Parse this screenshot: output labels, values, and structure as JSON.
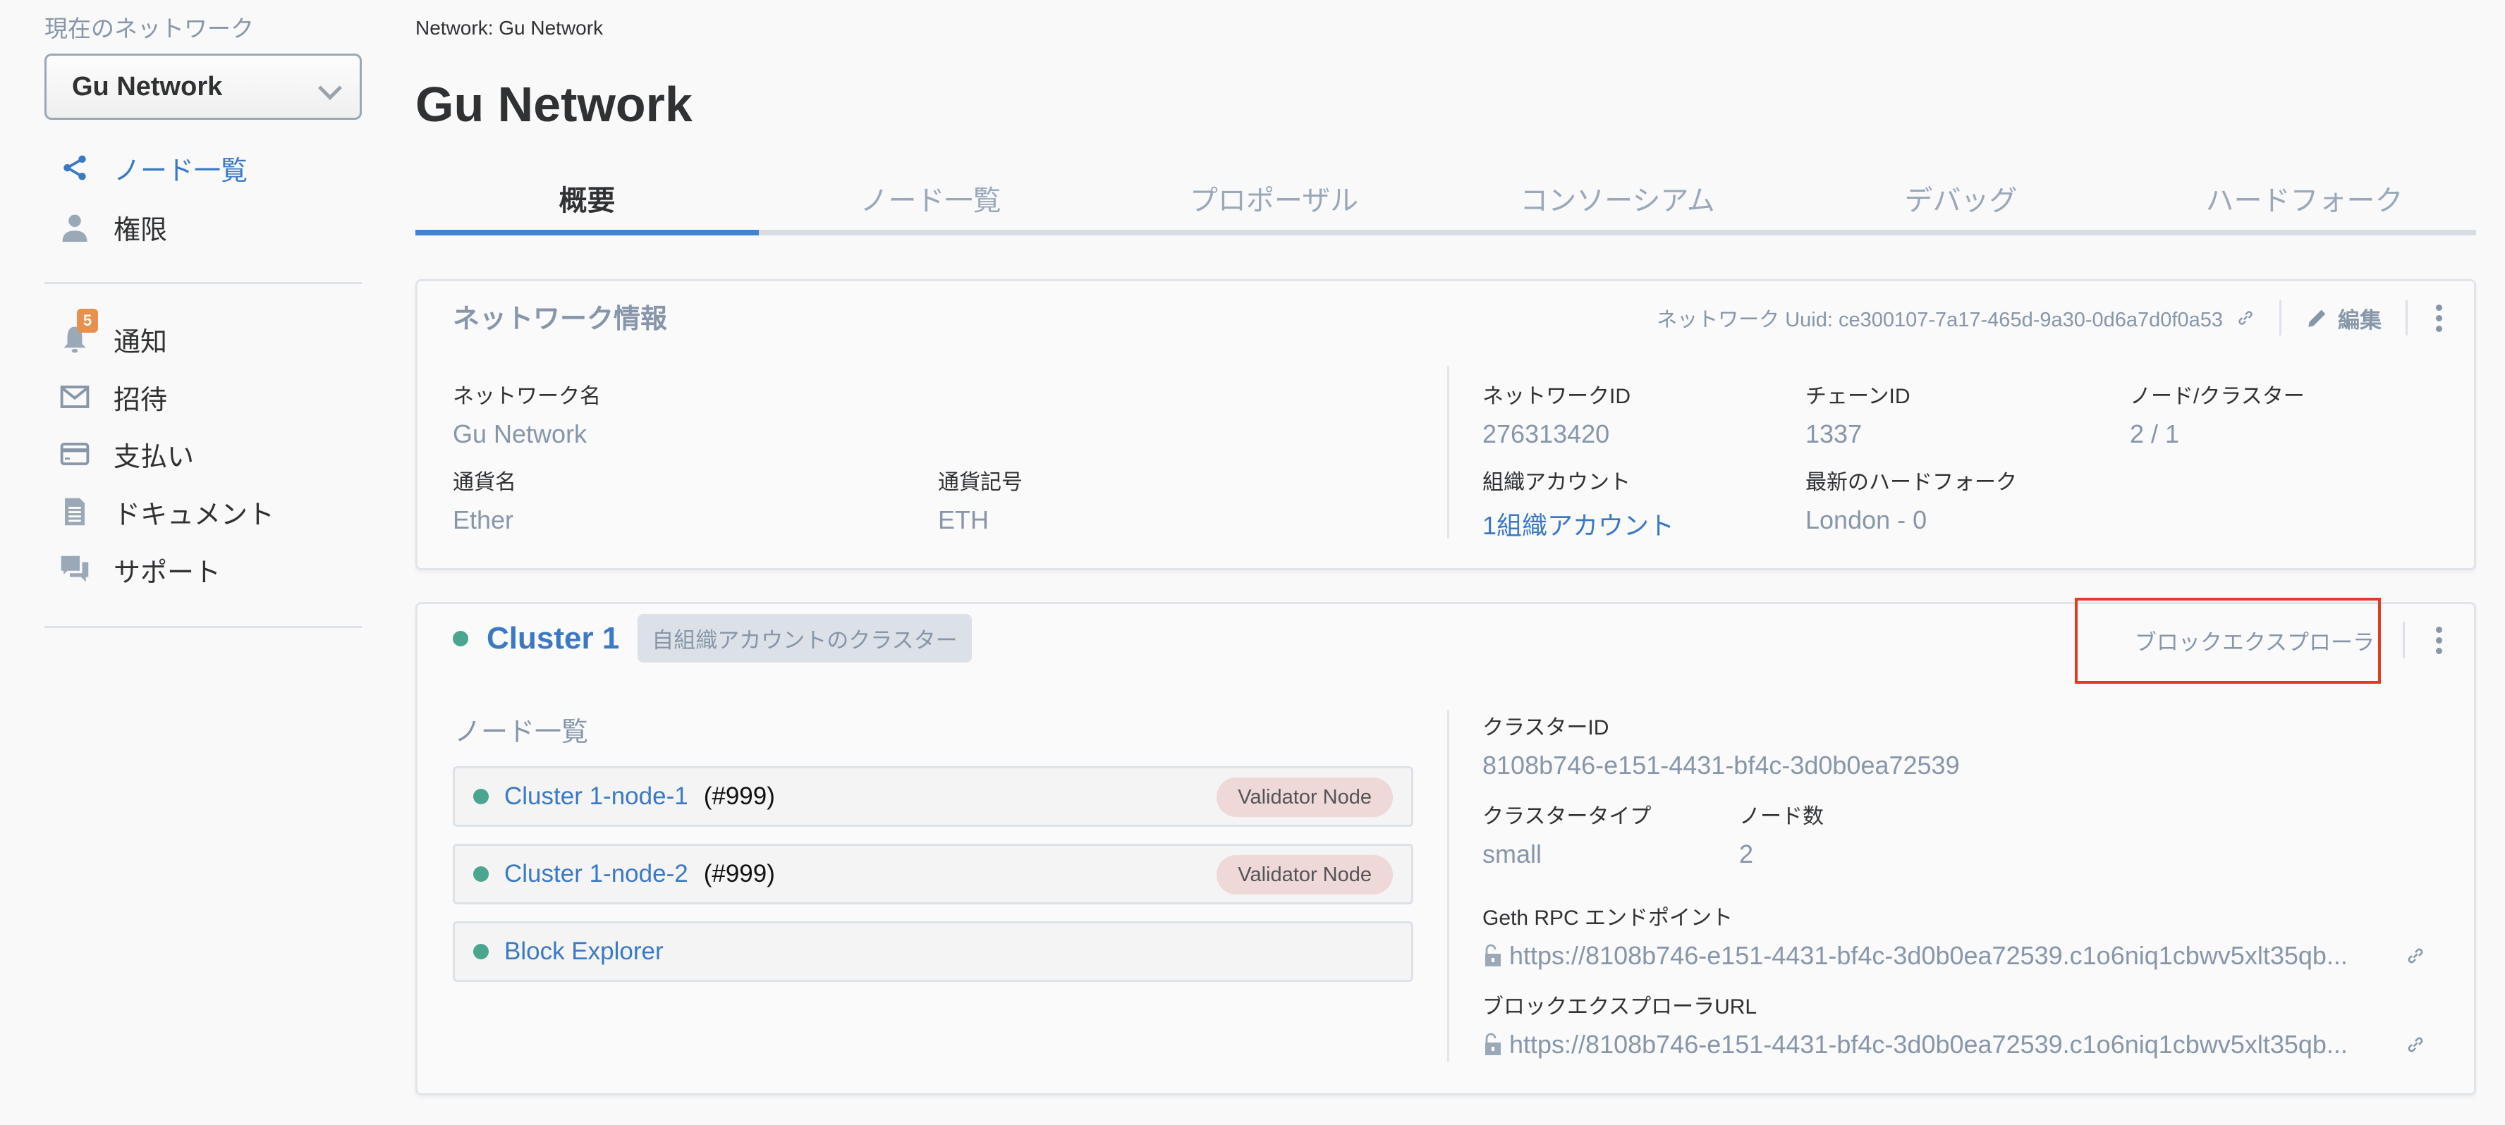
{
  "sidebar": {
    "current_network_label": "現在のネットワーク",
    "network_select_value": "Gu Network",
    "items": [
      {
        "label": "ノード一覧",
        "icon": "share-icon",
        "active": true
      },
      {
        "label": "権限",
        "icon": "user-icon"
      },
      {
        "label": "通知",
        "icon": "bell-icon",
        "badge": "5"
      },
      {
        "label": "招待",
        "icon": "mail-icon"
      },
      {
        "label": "支払い",
        "icon": "credit-card-icon"
      },
      {
        "label": "ドキュメント",
        "icon": "document-icon"
      },
      {
        "label": "サポート",
        "icon": "chat-icon"
      }
    ]
  },
  "header": {
    "breadcrumb": "Network: Gu Network",
    "title": "Gu Network"
  },
  "tabs": [
    {
      "label": "概要",
      "active": true
    },
    {
      "label": "ノード一覧"
    },
    {
      "label": "プロポーザル"
    },
    {
      "label": "コンソーシアム"
    },
    {
      "label": "デバッグ"
    },
    {
      "label": "ハードフォーク"
    }
  ],
  "network_info": {
    "title": "ネットワーク情報",
    "uuid_text": "ネットワーク Uuid: ce300107-7a17-465d-9a30-0d6a7d0f0a53",
    "edit_label": "編集",
    "fields": {
      "network_name": {
        "label": "ネットワーク名",
        "value": "Gu Network"
      },
      "currency_name": {
        "label": "通貨名",
        "value": "Ether"
      },
      "currency_symbol": {
        "label": "通貨記号",
        "value": "ETH"
      },
      "network_id": {
        "label": "ネットワークID",
        "value": "276313420"
      },
      "chain_id": {
        "label": "チェーンID",
        "value": "1337"
      },
      "node_cluster": {
        "label": "ノード/クラスター",
        "value": "2 / 1"
      },
      "org_account": {
        "label": "組織アカウント",
        "value": "1組織アカウント"
      },
      "latest_hardfork": {
        "label": "最新のハードフォーク",
        "value": "London - 0"
      }
    }
  },
  "cluster": {
    "name": "Cluster 1",
    "tag": "自組織アカウントのクラスター",
    "status_color": "#4ca58f",
    "block_explorer_button": "ブロックエクスプローラ",
    "node_list_title": "ノード一覧",
    "nodes": [
      {
        "name": "Cluster 1-node-1",
        "number": "(#999)",
        "role": "Validator Node"
      },
      {
        "name": "Cluster 1-node-2",
        "number": "(#999)",
        "role": "Validator Node"
      },
      {
        "name": "Block Explorer",
        "number": "",
        "role": ""
      }
    ],
    "fields": {
      "cluster_id": {
        "label": "クラスターID",
        "value": "8108b746-e151-4431-bf4c-3d0b0ea72539"
      },
      "cluster_type": {
        "label": "クラスタータイプ",
        "value": "small"
      },
      "node_count": {
        "label": "ノード数",
        "value": "2"
      },
      "geth_rpc": {
        "label": "Geth RPC エンドポイント",
        "value": "https://8108b746-e151-4431-bf4c-3d0b0ea72539.c1o6niq1cbwv5xlt35qb..."
      },
      "explorer_url": {
        "label": "ブロックエクスプローラURL",
        "value": "https://8108b746-e151-4431-bf4c-3d0b0ea72539.c1o6niq1cbwv5xlt35qb..."
      }
    }
  },
  "colors": {
    "accent": "#4282d3",
    "link": "#3b79c4",
    "muted": "#8796a8",
    "badge": "#e8914f",
    "highlight": "#e33b22"
  }
}
